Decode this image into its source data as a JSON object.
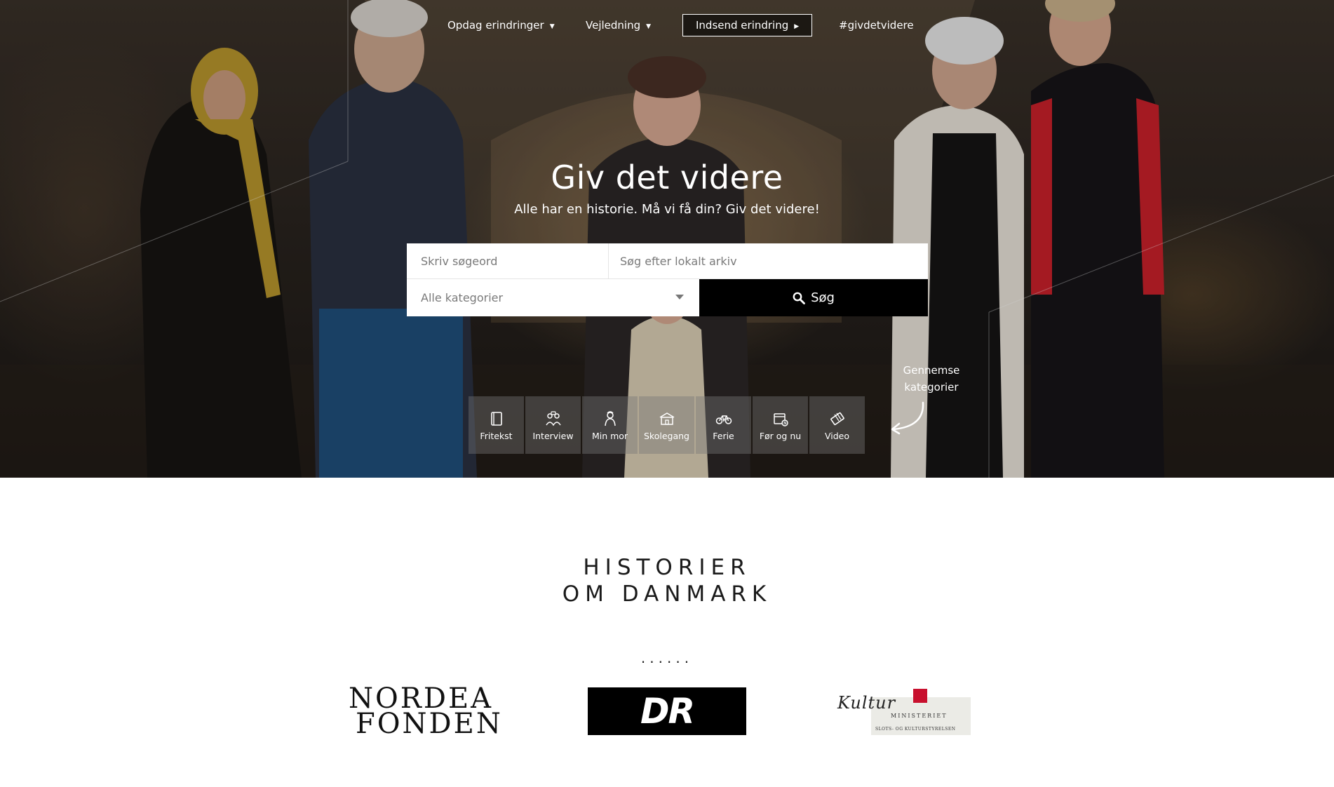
{
  "nav": {
    "discover_label": "Opdag erindringer",
    "guide_label": "Vejledning",
    "submit_label": "Indsend erindring",
    "hashtag_label": "#givdetvidere"
  },
  "hero": {
    "title": "Giv det videre",
    "subtitle": "Alle har en historie. Må vi få din? Giv det videre!"
  },
  "search": {
    "keyword_placeholder": "Skriv søgeord",
    "archive_placeholder": "Søg efter lokalt arkiv",
    "category_selected": "Alle kategorier",
    "button_label": "Søg"
  },
  "categories": {
    "browse_hint": "Gennemse kategorier",
    "items": [
      {
        "label": "Fritekst",
        "icon": "book-icon"
      },
      {
        "label": "Interview",
        "icon": "interview-icon"
      },
      {
        "label": "Min mor",
        "icon": "mother-icon"
      },
      {
        "label": "Skolegang",
        "icon": "school-icon"
      },
      {
        "label": "Ferie",
        "icon": "bicycle-icon"
      },
      {
        "label": "Før og nu",
        "icon": "calendar-icon"
      },
      {
        "label": "Video",
        "icon": "film-icon"
      }
    ]
  },
  "brand": {
    "title_line1": "HISTORIER",
    "title_line2": "OM DANMARK",
    "dots": "......"
  },
  "sponsors": {
    "nordea_line1": "NORDEA",
    "nordea_line2": "FONDEN",
    "dr": "DR",
    "kultur_word": "Kultur",
    "kultur_sub1": "MINISTERIET",
    "kultur_sub2": "SLOTS- OG KULTURSTYRELSEN"
  },
  "colors": {
    "search_button": "#000000",
    "tile_background": "#787878",
    "kultur_crown": "#c8102e"
  }
}
